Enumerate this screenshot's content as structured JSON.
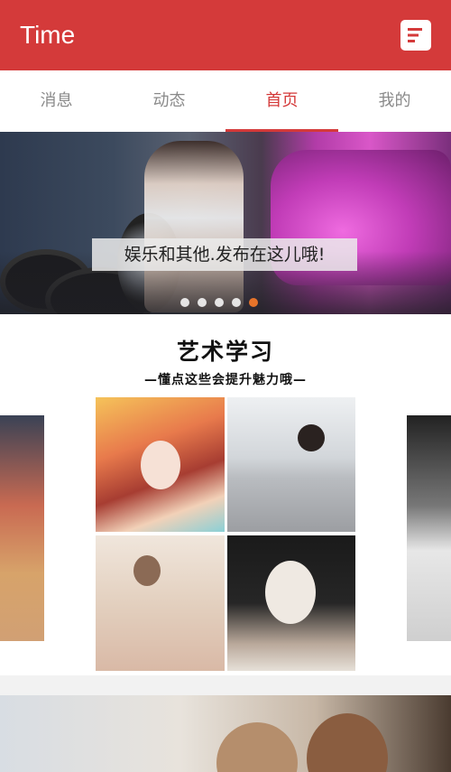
{
  "appbar": {
    "title": "Time",
    "menu_icon": "menu-lines-icon",
    "accent": "#d43a3a"
  },
  "tabs": [
    {
      "label": "消息",
      "active": false
    },
    {
      "label": "动态",
      "active": false
    },
    {
      "label": "首页",
      "active": true
    },
    {
      "label": "我的",
      "active": false
    }
  ],
  "banner": {
    "caption": "娱乐和其他.发布在这儿哦!",
    "page_count": 5,
    "current_index": 4
  },
  "feature": {
    "title": "艺术学习",
    "subtitle": "—懂点这些会提升魅力哦—"
  }
}
